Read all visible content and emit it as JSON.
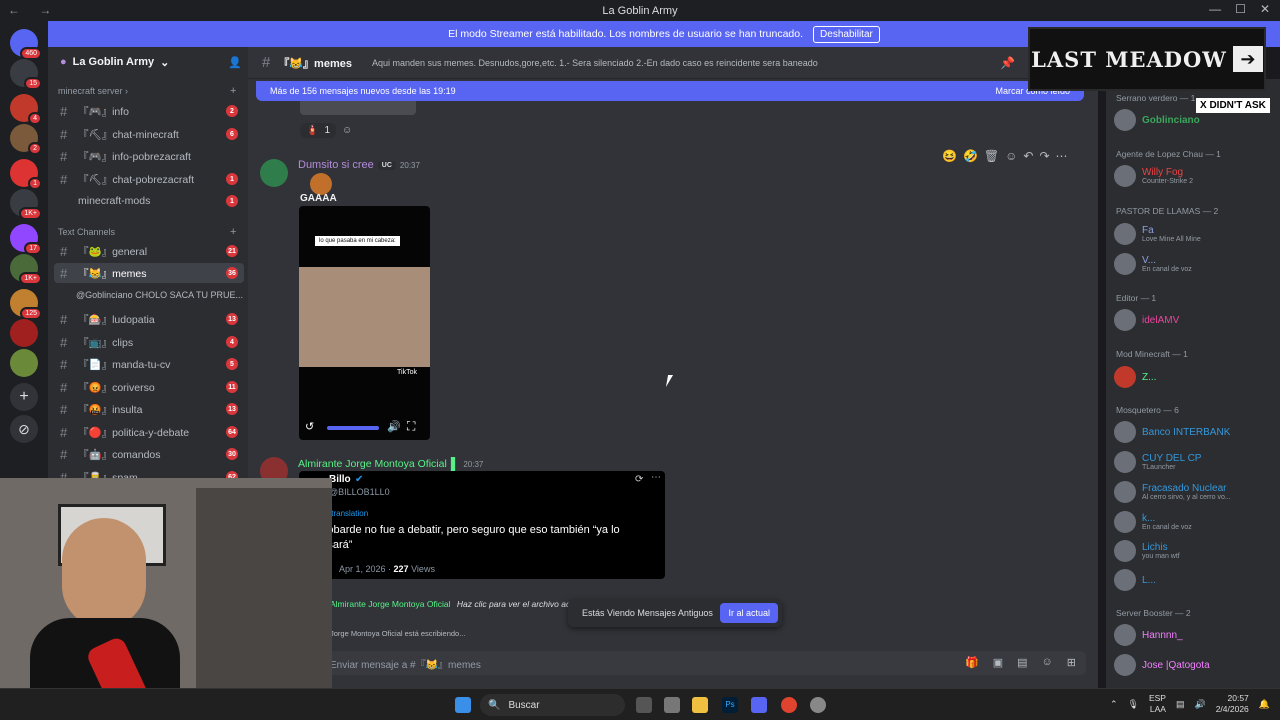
{
  "window": {
    "title": "La Goblin Army",
    "controls": [
      "—",
      "☐",
      "✕"
    ]
  },
  "streamer_bar": {
    "text": "El modo Streamer está habilitado. Los nombres de usuario se han truncado.",
    "button": "Deshabilitar"
  },
  "guilds": [
    {
      "badge": "460"
    },
    {
      "badge": "15"
    },
    {
      "badge": "4"
    },
    {
      "badge": "2"
    },
    {
      "badge": "1"
    },
    {
      "badge": "1K+"
    },
    {
      "badge": "17"
    },
    {
      "badge": "1K+"
    },
    {
      "badge": "125"
    },
    {
      "badge": ""
    },
    {
      "badge": ""
    }
  ],
  "server": {
    "name": "La Goblin Army"
  },
  "categories": {
    "minecraft": "minecraft server",
    "text": "Text Channels"
  },
  "channels": [
    {
      "name": "『🎮』info",
      "count": "2"
    },
    {
      "name": "『⛏』chat-minecraft",
      "count": "6"
    },
    {
      "name": "『🎮』info-pobrezacraft",
      "count": ""
    },
    {
      "name": "『⛏』chat-pobrezacraft",
      "count": "1"
    },
    {
      "name": "minecraft-mods",
      "count": "1"
    },
    {
      "name": "『🐸』general",
      "count": "21"
    },
    {
      "name": "『😹』memes",
      "count": "36"
    },
    {
      "name": "『🎰』ludopatia",
      "count": "13"
    },
    {
      "name": "『📺』clips",
      "count": "4"
    },
    {
      "name": "『📄』manda-tu-cv",
      "count": "5"
    },
    {
      "name": "『😡』coriverso",
      "count": "11"
    },
    {
      "name": "『🤬』insulta",
      "count": "13"
    },
    {
      "name": "『🔴』politica-y-debate",
      "count": "64"
    },
    {
      "name": "『🤖』comandos",
      "count": "30"
    },
    {
      "name": "『🥫』spam",
      "count": "62"
    }
  ],
  "thread": "@Goblinciano CHOLO SACA TU PRUE...",
  "header": {
    "channel": "『😹』memes",
    "topic": "Aqui manden sus memes. Desnudos,gore,etc. 1.- Sera silenciado 2.-En dado caso es reincidente sera baneado"
  },
  "new_messages": {
    "text": "Más de 156 mensajes nuevos desde las 19:19",
    "action": "Marcar como leído"
  },
  "reaction": {
    "emoji": "🧯",
    "count": "1"
  },
  "message1": {
    "author": "Dumsito si cree",
    "tag": "UC",
    "time": "20:37",
    "text": "GAAAA",
    "video_caption": "lo que pasaba en mi cabeza:",
    "video_watermark": "TikTok"
  },
  "message2": {
    "author": "Almirante Jorge Montoya Oficial",
    "time": "20:37",
    "tweet": {
      "name": "Billo",
      "handle": "@BILLOB1LL0",
      "translation": "Show translation",
      "text": "El cobarde no fue a debatir, pero seguro que eso también “ya lo pensará”",
      "date": "Apr 1, 2026",
      "views": "227",
      "views_label": "Views"
    }
  },
  "reply_line": {
    "author": "Almirante Jorge Montoya Oficial",
    "text": "Haz clic para ver el archivo adjunto"
  },
  "typing": "Jorge Montoya Oficial está escribiendo...",
  "old_messages": {
    "text": "Estás Viendo Mensajes Antiguos",
    "button": "Ir al actual"
  },
  "input": {
    "placeholder": "Enviar mensaje a #『😹』memes"
  },
  "members": {
    "groups": [
      {
        "title": "Serrano verdero — 1",
        "members": [
          {
            "name": "Goblinciano",
            "status": "",
            "color": "#3ba55c"
          }
        ]
      },
      {
        "title": "Agente de Lopez Chau — 1",
        "members": [
          {
            "name": "Willy Fog",
            "status": "Counter-Strike 2",
            "color": "#ed4245"
          }
        ]
      },
      {
        "title": "PASTOR DE LLAMAS — 2",
        "members": [
          {
            "name": "Fa",
            "status": "Love Mine All Mine",
            "color": "#8ea1e1"
          },
          {
            "name": "V...",
            "status": "En canal de voz",
            "color": "#8ea1e1"
          }
        ]
      },
      {
        "title": "Editor — 1",
        "members": [
          {
            "name": "idelAMV",
            "status": "",
            "color": "#eb459e"
          }
        ]
      },
      {
        "title": "Mod Minecraft — 1",
        "members": [
          {
            "name": "Z...",
            "status": "",
            "color": "#57f287"
          }
        ]
      },
      {
        "title": "Mosquetero — 6",
        "members": [
          {
            "name": "Banco INTERBANK",
            "status": "",
            "color": "#3498db"
          },
          {
            "name": "CUY DEL CP",
            "status": "TLauncher",
            "color": "#3498db"
          },
          {
            "name": "Fracasado Nuclear",
            "status": "Al cerro sirvo, y al cerro vo...",
            "color": "#3498db"
          },
          {
            "name": "k...",
            "status": "En canal de voz",
            "color": "#3498db"
          },
          {
            "name": "Lichis",
            "status": "you man wtf",
            "color": "#3498db"
          },
          {
            "name": "L...",
            "status": "",
            "color": "#3498db"
          }
        ]
      },
      {
        "title": "Server Booster — 2",
        "members": [
          {
            "name": "Hannnn_",
            "status": "",
            "color": "#f47fff"
          },
          {
            "name": "Jose |Qatogota",
            "status": "",
            "color": "#f47fff"
          }
        ]
      }
    ]
  },
  "overlay": {
    "banner": "LAST MEADOW",
    "caption": "X DIDN'T ASK"
  },
  "taskbar": {
    "search": "Buscar",
    "lang": "ESP",
    "lang2": "LAA",
    "time": "20:57",
    "date": "2/4/2026"
  }
}
